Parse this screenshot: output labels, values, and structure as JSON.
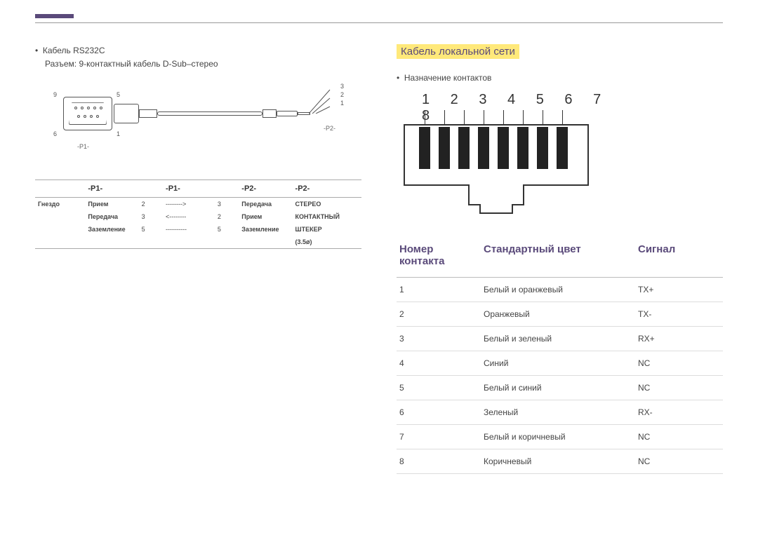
{
  "left": {
    "cable_label": "Кабель RS232C",
    "connector_label": "Разъем: 9-контактный кабель D-Sub–стерео",
    "db9_labels": {
      "tl": "9",
      "tr": "5",
      "bl": "6",
      "br": "1"
    },
    "stereo_pins": {
      "a": "3",
      "b": "2",
      "c": "1"
    },
    "p1_label": "-P1-",
    "p2_label": "-P2-",
    "table": {
      "headers": [
        "-P1-",
        "-P1-",
        "-P2-",
        "-P2-"
      ],
      "row_labels": {
        "gnezdo": "Гнездо"
      },
      "rows": [
        {
          "side": "Гнездо",
          "p1_name": "Прием",
          "p1_pin": "2",
          "arrow": "-------->",
          "p2_pin": "3",
          "p2_name": "Передача",
          "stereo": "СТЕРЕО"
        },
        {
          "side": "",
          "p1_name": "Передача",
          "p1_pin": "3",
          "arrow": "<--------",
          "p2_pin": "2",
          "p2_name": "Прием",
          "stereo": "КОНТАКТНЫЙ"
        },
        {
          "side": "",
          "p1_name": "Заземление",
          "p1_pin": "5",
          "arrow": "----------",
          "p2_pin": "5",
          "p2_name": "Заземление",
          "stereo": "ШТЕКЕР"
        },
        {
          "side": "",
          "p1_name": "",
          "p1_pin": "",
          "arrow": "",
          "p2_pin": "",
          "p2_name": "",
          "stereo": "(3.5ø)"
        }
      ]
    }
  },
  "right": {
    "title": "Кабель локальной сети",
    "assignment": "Назначение контактов",
    "rj45_numbers": "1 2 3 4 5 6 7 8",
    "lan_table": {
      "headers": {
        "pin": "Номер контакта",
        "color": "Стандартный цвет",
        "signal": "Сигнал"
      },
      "rows": [
        {
          "pin": "1",
          "color": "Белый и оранжевый",
          "signal": "TX+"
        },
        {
          "pin": "2",
          "color": "Оранжевый",
          "signal": "TX-"
        },
        {
          "pin": "3",
          "color": "Белый и зеленый",
          "signal": "RX+"
        },
        {
          "pin": "4",
          "color": "Синий",
          "signal": "NC"
        },
        {
          "pin": "5",
          "color": "Белый и синий",
          "signal": "NC"
        },
        {
          "pin": "6",
          "color": "Зеленый",
          "signal": "RX-"
        },
        {
          "pin": "7",
          "color": "Белый и коричневый",
          "signal": "NC"
        },
        {
          "pin": "8",
          "color": "Коричневый",
          "signal": "NC"
        }
      ]
    }
  }
}
